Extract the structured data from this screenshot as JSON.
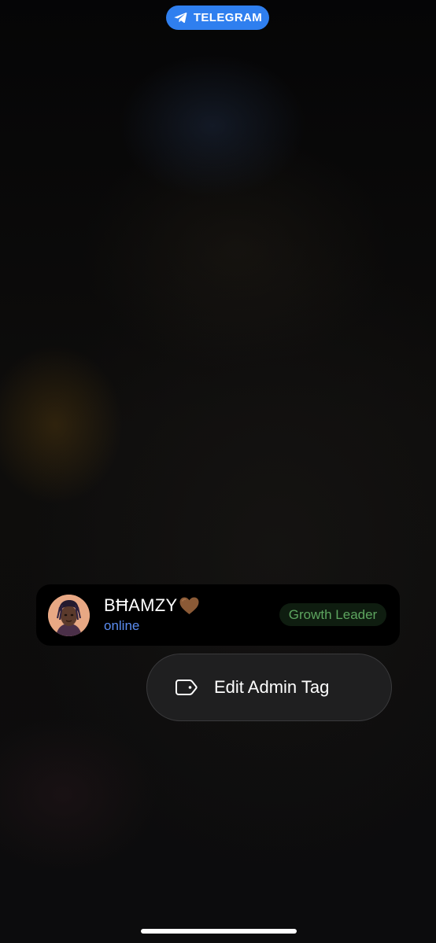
{
  "badge": {
    "label": "TELEGRAM",
    "icon": "telegram-plane-icon",
    "color": "#2f7fef"
  },
  "user": {
    "name": "BĦAMZY",
    "emoji_icon": "brown-heart-icon",
    "status": "online",
    "status_color": "#5b8df2",
    "admin_tag": "Growth Leader",
    "admin_tag_color": "#5da55f",
    "avatar_icon": "avatar-illustration"
  },
  "context_menu": {
    "items": [
      {
        "label": "Edit Admin Tag",
        "icon": "tag-icon"
      }
    ]
  }
}
